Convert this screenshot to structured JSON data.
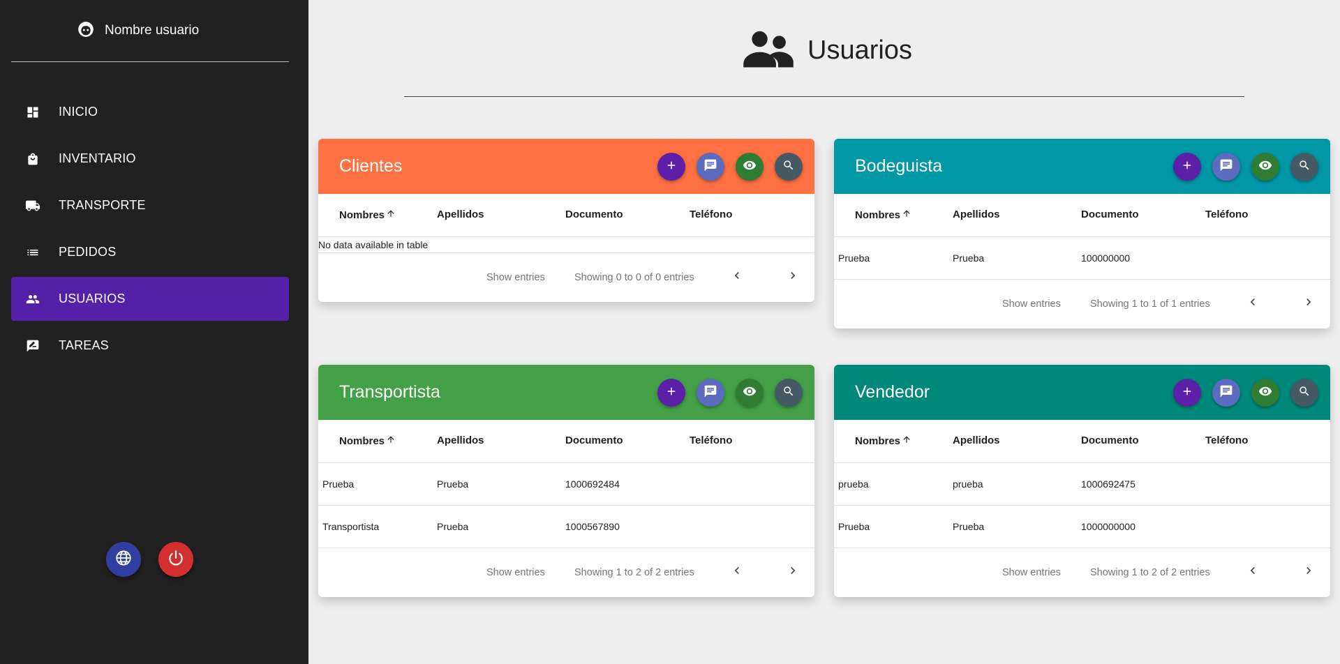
{
  "sidebar": {
    "user_name": "Nombre usuario",
    "user_icon": "face-icon",
    "items": [
      {
        "label": "INICIO",
        "icon": "dashboard-icon",
        "active": false
      },
      {
        "label": "INVENTARIO",
        "icon": "shopping-bag-icon",
        "active": false
      },
      {
        "label": "TRANSPORTE",
        "icon": "truck-icon",
        "active": false
      },
      {
        "label": "PEDIDOS",
        "icon": "list-icon",
        "active": false
      },
      {
        "label": "USUARIOS",
        "icon": "users-icon",
        "active": true
      },
      {
        "label": "TAREAS",
        "icon": "rate-review-icon",
        "active": false
      }
    ],
    "bottom_buttons": [
      {
        "icon": "globe-icon",
        "color": "#303f9f"
      },
      {
        "icon": "power-icon",
        "color": "#d32f2f"
      }
    ]
  },
  "page": {
    "title": "Usuarios",
    "icon": "people-icon"
  },
  "table_columns": [
    "Nombres",
    "Apellidos",
    "Documento",
    "Teléfono"
  ],
  "cards": [
    {
      "title": "Clientes",
      "color": "#ff7043",
      "empty_text": "No data available in table",
      "rows": [],
      "show_entries": "Show entries",
      "info": "Showing 0 to 0 of 0 entries"
    },
    {
      "title": "Bodeguista",
      "color": "#0097a7",
      "rows": [
        {
          "nombres": "Prueba",
          "apellidos": "Prueba",
          "documento": "100000000",
          "telefono": ""
        }
      ],
      "show_entries": "Show entries",
      "info": "Showing 1 to 1 of 1 entries"
    },
    {
      "title": "Transportista",
      "color": "#43a047",
      "rows": [
        {
          "nombres": "Prueba",
          "apellidos": "Prueba",
          "documento": "1000692484",
          "telefono": ""
        },
        {
          "nombres": "Transportista",
          "apellidos": "Prueba",
          "documento": "1000567890",
          "telefono": ""
        }
      ],
      "show_entries": "Show entries",
      "info": "Showing 1 to 2 of 2 entries"
    },
    {
      "title": "Vendedor",
      "color": "#00897b",
      "rows": [
        {
          "nombres": "prueba",
          "apellidos": "prueba",
          "documento": "1000692475",
          "telefono": ""
        },
        {
          "nombres": "Prueba",
          "apellidos": "Prueba",
          "documento": "1000000000",
          "telefono": ""
        }
      ],
      "show_entries": "Show entries",
      "info": "Showing 1 to 2 of 2 entries"
    }
  ],
  "card_actions": [
    "add-icon",
    "message-icon",
    "eye-icon",
    "search-icon"
  ]
}
